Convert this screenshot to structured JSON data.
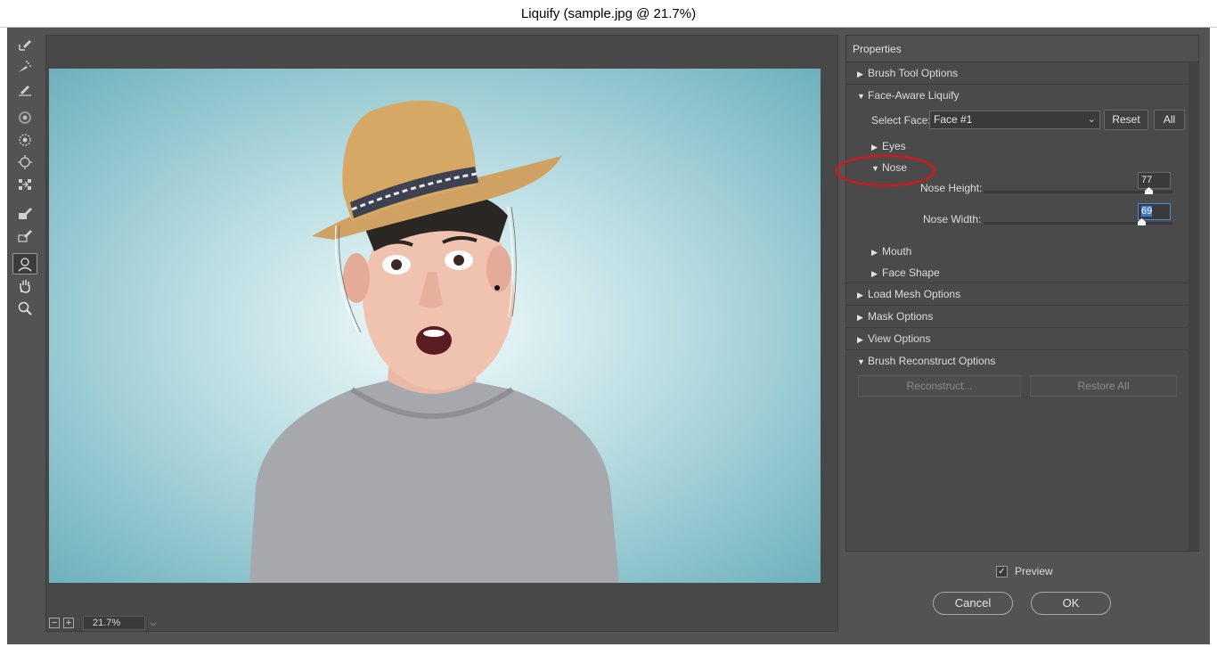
{
  "window": {
    "title": "Liquify (sample.jpg @ 21.7%)"
  },
  "tools": [
    "forward-warp",
    "reconstruct",
    "smooth",
    "twirl",
    "pucker",
    "bloat",
    "push-left",
    "freeze-mask",
    "thaw-mask",
    "face",
    "hand",
    "zoom"
  ],
  "zoom": {
    "minus": "−",
    "plus": "+",
    "value": "21.7%"
  },
  "panel": {
    "title": "Properties",
    "sections": {
      "brush_tool": "Brush Tool Options",
      "face_aware": "Face-Aware Liquify",
      "load_mesh": "Load Mesh Options",
      "mask": "Mask Options",
      "view": "View Options",
      "brush_reconstruct": "Brush Reconstruct Options"
    },
    "face": {
      "select_label": "Select Face:",
      "selected": "Face #1",
      "reset": "Reset",
      "all": "All"
    },
    "eyes": "Eyes",
    "nose": {
      "label": "Nose",
      "height_label": "Nose Height:",
      "height_value": "77",
      "width_label": "Nose Width:",
      "width_value": "69"
    },
    "mouth": "Mouth",
    "face_shape": "Face Shape",
    "reconstruct": "Reconstruct...",
    "restore_all": "Restore All"
  },
  "footer": {
    "preview": "Preview",
    "preview_checked": true,
    "cancel": "Cancel",
    "ok": "OK"
  },
  "colors": {
    "highlight": "#d0191f"
  }
}
